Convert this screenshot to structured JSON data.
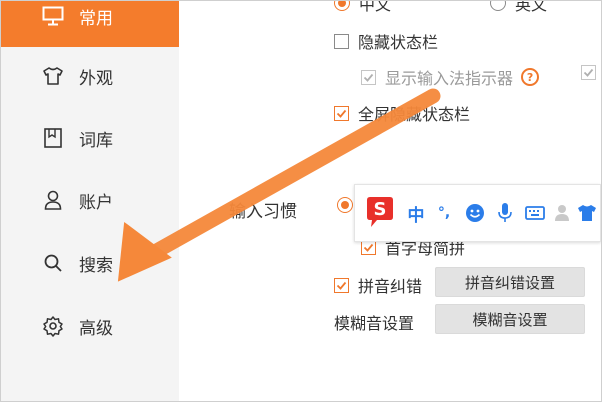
{
  "sidebar": {
    "items": [
      {
        "label": "常用",
        "icon": "monitor-icon",
        "active": true
      },
      {
        "label": "外观",
        "icon": "tshirt-icon",
        "active": false
      },
      {
        "label": "词库",
        "icon": "book-icon",
        "active": false
      },
      {
        "label": "账户",
        "icon": "user-icon",
        "active": false
      },
      {
        "label": "搜索",
        "icon": "search-icon",
        "active": false
      },
      {
        "label": "高级",
        "icon": "gear-icon",
        "active": false
      }
    ]
  },
  "content": {
    "lang_cn": "中文",
    "lang_en": "英文",
    "hide_statusbar": "隐藏状态栏",
    "show_ime_indicator": "显示输入法指示器",
    "fullscreen_hide_statusbar": "全屏隐藏状态栏",
    "input_habit": "输入习惯",
    "initial_abbr": "首字母简拼",
    "pinyin_correct": "拼音纠错",
    "pinyin_correct_settings": "拼音纠错设置",
    "fuzzy_settings_label": "模糊音设置",
    "fuzzy_settings_button": "模糊音设置"
  },
  "toolbar": {
    "logo": "S",
    "mode": "中",
    "punct": "°,",
    "icons": [
      "emoji-icon",
      "microphone-icon",
      "keyboard-icon",
      "user-icon",
      "skin-icon"
    ]
  },
  "colors": {
    "accent": "#f47c2c",
    "sidebar_bg": "#f4f4f4",
    "button_bg": "#e3e3e3",
    "sogou_red": "#e8302a",
    "sogou_blue": "#2b7de9"
  }
}
